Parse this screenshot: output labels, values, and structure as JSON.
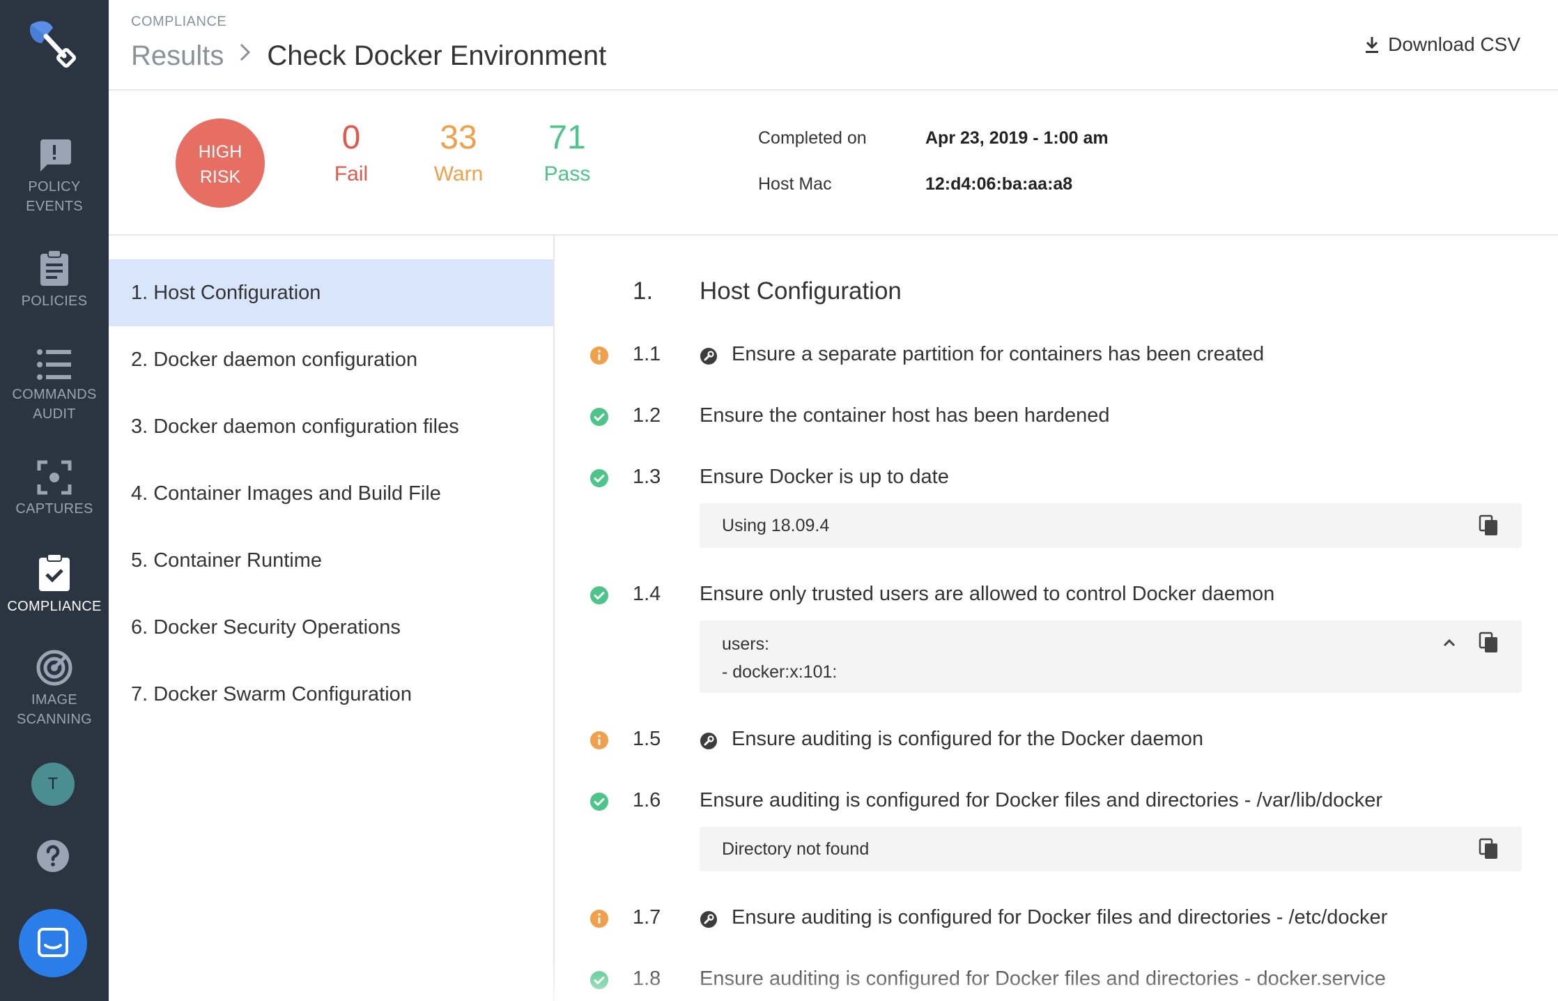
{
  "nav": {
    "items": [
      {
        "label": "POLICY\nEVENTS",
        "icon": "alert-message-icon"
      },
      {
        "label": "POLICIES",
        "icon": "clipboard-icon"
      },
      {
        "label": "COMMANDS\nAUDIT",
        "icon": "list-icon"
      },
      {
        "label": "CAPTURES",
        "icon": "capture-icon"
      },
      {
        "label": "COMPLIANCE",
        "icon": "compliance-check-icon"
      },
      {
        "label": "IMAGE\nSCANNING",
        "icon": "radar-icon"
      }
    ],
    "avatar_initial": "T"
  },
  "header": {
    "section": "COMPLIANCE",
    "breadcrumb_parent": "Results",
    "breadcrumb_current": "Check Docker Environment",
    "download_label": "Download CSV"
  },
  "summary": {
    "risk_line1": "HIGH",
    "risk_line2": "RISK",
    "fail_count": "0",
    "fail_label": "Fail",
    "warn_count": "33",
    "warn_label": "Warn",
    "pass_count": "71",
    "pass_label": "Pass",
    "completed_label": "Completed on",
    "completed_value": "Apr 23, 2019 - 1:00 am",
    "host_label": "Host Mac",
    "host_value": "12:d4:06:ba:aa:a8"
  },
  "sections": [
    "1. Host Configuration",
    "2. Docker daemon configuration",
    "3. Docker daemon configuration files",
    "4. Container Images and Build File",
    "5. Container Runtime",
    "6. Docker Security Operations",
    "7. Docker Swarm Configuration"
  ],
  "content": {
    "heading_num": "1.",
    "heading_title": "Host Configuration",
    "checks": [
      {
        "num": "1.1",
        "status": "warn",
        "text": "Ensure a separate partition for containers has been created"
      },
      {
        "num": "1.2",
        "status": "pass",
        "text": "Ensure the container host has been hardened"
      },
      {
        "num": "1.3",
        "status": "pass",
        "text": "Ensure Docker is up to date",
        "output": "Using 18.09.4"
      },
      {
        "num": "1.4",
        "status": "pass",
        "text": "Ensure only trusted users are allowed to control Docker daemon",
        "output_line1": "users:",
        "output_line2": "- docker:x:101:"
      },
      {
        "num": "1.5",
        "status": "warn",
        "text": "Ensure auditing is configured for the Docker daemon"
      },
      {
        "num": "1.6",
        "status": "pass",
        "text": "Ensure auditing is configured for Docker files and directories - /var/lib/docker",
        "output": "Directory not found"
      },
      {
        "num": "1.7",
        "status": "warn",
        "text": "Ensure auditing is configured for Docker files and directories - /etc/docker"
      },
      {
        "num": "1.8",
        "status": "pass",
        "text": "Ensure auditing is configured for Docker files and directories - docker.service"
      }
    ]
  },
  "colors": {
    "nav_bg": "#2b3441",
    "risk_high": "#e66e63",
    "fail": "#e0594d",
    "warn": "#f0a04b",
    "pass": "#4dc58a",
    "active_section": "#d8e5fb"
  }
}
